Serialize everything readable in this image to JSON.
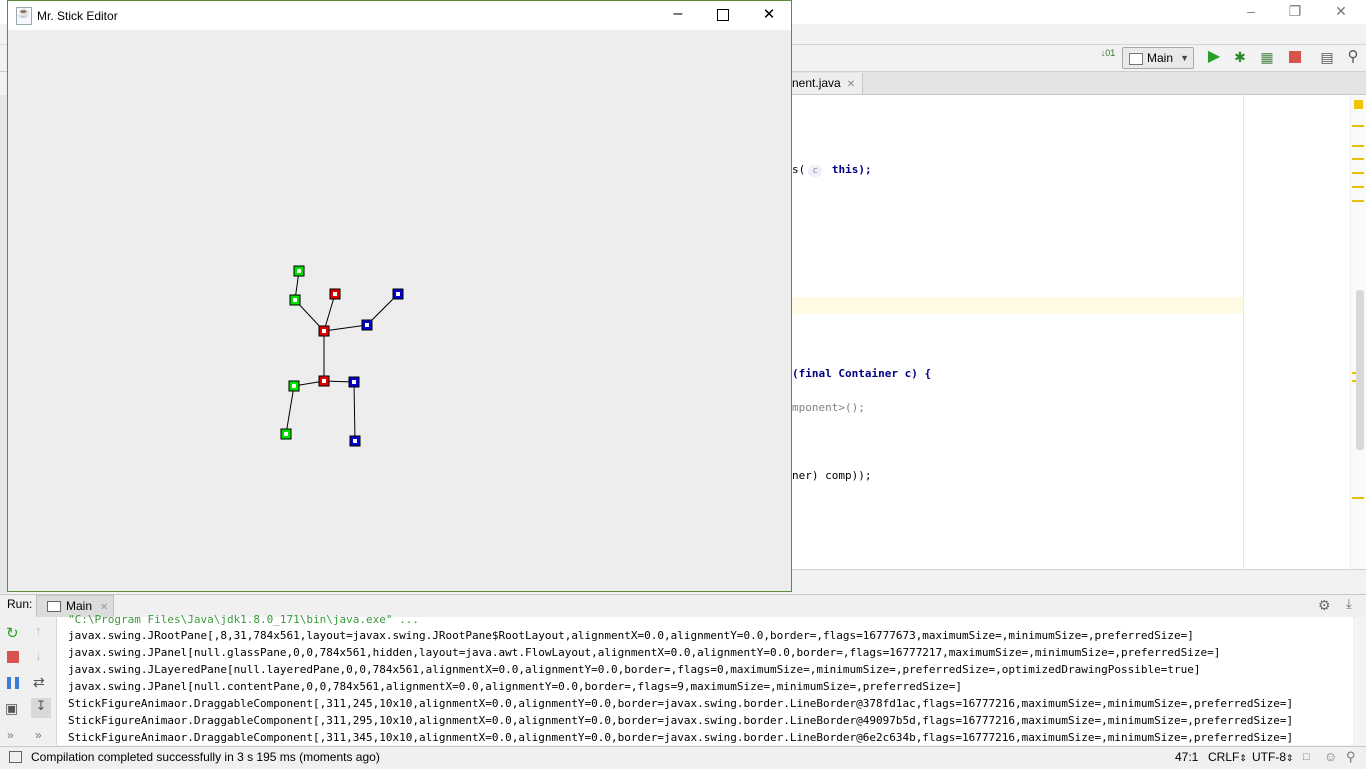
{
  "ide": {
    "run_config": "Main",
    "file_tab": "nent.java",
    "code_lines": [
      {
        "text": "s(",
        "hint": "c",
        "rest": " this);"
      },
      {
        "text": "(final Container c) {"
      },
      {
        "text": "mponent>();"
      },
      {
        "text": "ner) comp));"
      }
    ]
  },
  "app": {
    "title": "Mr. Stick Editor",
    "colors": {
      "green": "#00e000",
      "red": "#e00000",
      "blue": "#0000cc"
    }
  },
  "run_panel": {
    "label": "Run:",
    "tab": "Main",
    "command": "\"C:\\Program Files\\Java\\jdk1.8.0_171\\bin\\java.exe\" ...",
    "lines": [
      "javax.swing.JRootPane[,8,31,784x561,layout=javax.swing.JRootPane$RootLayout,alignmentX=0.0,alignmentY=0.0,border=,flags=16777673,maximumSize=,minimumSize=,preferredSize=]",
      "javax.swing.JPanel[null.glassPane,0,0,784x561,hidden,layout=java.awt.FlowLayout,alignmentX=0.0,alignmentY=0.0,border=,flags=16777217,maximumSize=,minimumSize=,preferredSize=]",
      "javax.swing.JLayeredPane[null.layeredPane,0,0,784x561,alignmentX=0.0,alignmentY=0.0,border=,flags=0,maximumSize=,minimumSize=,preferredSize=,optimizedDrawingPossible=true]",
      "javax.swing.JPanel[null.contentPane,0,0,784x561,alignmentX=0.0,alignmentY=0.0,border=,flags=9,maximumSize=,minimumSize=,preferredSize=]",
      "StickFigureAnimaor.DraggableComponent[,311,245,10x10,alignmentX=0.0,alignmentY=0.0,border=javax.swing.border.LineBorder@378fd1ac,flags=16777216,maximumSize=,minimumSize=,preferredSize=]",
      "StickFigureAnimaor.DraggableComponent[,311,295,10x10,alignmentX=0.0,alignmentY=0.0,border=javax.swing.border.LineBorder@49097b5d,flags=16777216,maximumSize=,minimumSize=,preferredSize=]",
      "StickFigureAnimaor.DraggableComponent[,311,345,10x10,alignmentX=0.0,alignmentY=0.0,border=javax.swing.border.LineBorder@6e2c634b,flags=16777216,maximumSize=,minimumSize=,preferredSize=]"
    ]
  },
  "status": {
    "message": "Compilation completed successfully in 3 s 195 ms (moments ago)",
    "position": "47:1",
    "line_sep": "CRLF",
    "encoding": "UTF-8"
  }
}
